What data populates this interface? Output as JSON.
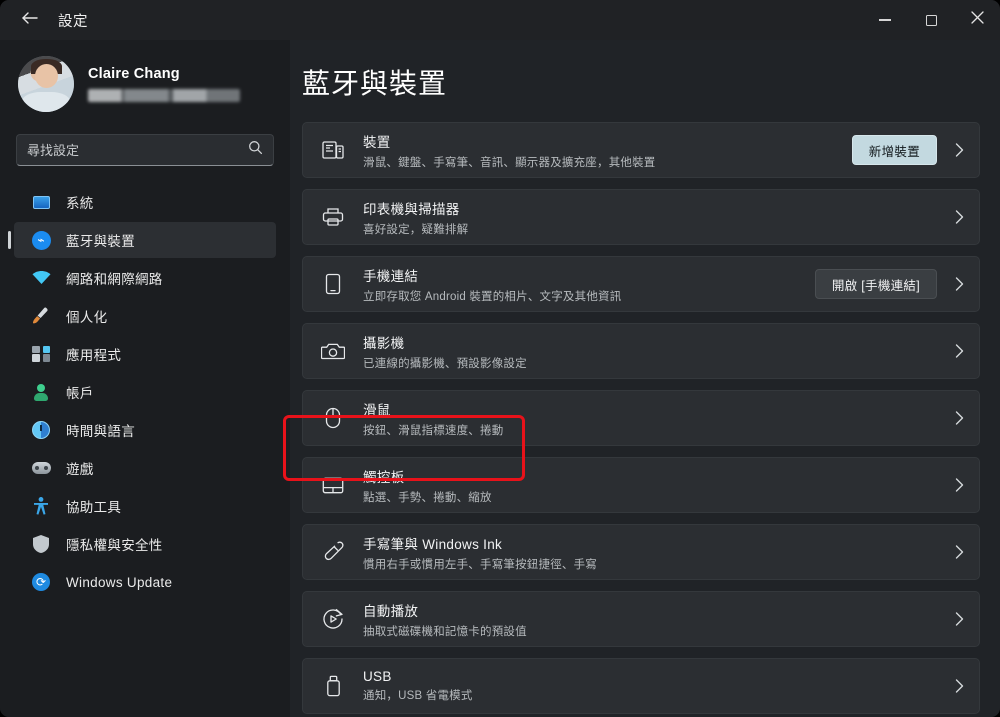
{
  "window": {
    "title": "設定",
    "back_icon": "back-arrow-icon",
    "controls": {
      "minimize": "minimize-icon",
      "maximize": "maximize-icon",
      "close": "close-icon"
    }
  },
  "sidebar": {
    "profile": {
      "name": "Claire Chang",
      "email_redacted": true,
      "avatar": "user-avatar"
    },
    "search": {
      "placeholder": "尋找設定",
      "value": "",
      "icon": "search-icon"
    },
    "items": [
      {
        "label": "系統",
        "icon": "system-icon",
        "selected": false
      },
      {
        "label": "藍牙與裝置",
        "icon": "bluetooth-icon",
        "selected": true
      },
      {
        "label": "網路和網際網路",
        "icon": "wifi-icon",
        "selected": false
      },
      {
        "label": "個人化",
        "icon": "personalize-icon",
        "selected": false
      },
      {
        "label": "應用程式",
        "icon": "apps-icon",
        "selected": false
      },
      {
        "label": "帳戶",
        "icon": "account-icon",
        "selected": false
      },
      {
        "label": "時間與語言",
        "icon": "clock-icon",
        "selected": false
      },
      {
        "label": "遊戲",
        "icon": "gaming-icon",
        "selected": false
      },
      {
        "label": "協助工具",
        "icon": "accessibility-icon",
        "selected": false
      },
      {
        "label": "隱私權與安全性",
        "icon": "shield-icon",
        "selected": false
      },
      {
        "label": "Windows Update",
        "icon": "update-icon",
        "selected": false
      }
    ]
  },
  "main": {
    "title": "藍牙與裝置",
    "cards": [
      {
        "title": "裝置",
        "subtitle": "滑鼠、鍵盤、手寫筆、音訊、顯示器及擴充座，其他裝置",
        "icon": "devices-icon",
        "action": {
          "label": "新增裝置",
          "style": "accent"
        },
        "chevron": "chevron-right-icon"
      },
      {
        "title": "印表機與掃描器",
        "subtitle": "喜好設定，疑難排解",
        "icon": "printer-icon",
        "action": null,
        "chevron": "chevron-right-icon"
      },
      {
        "title": "手機連結",
        "subtitle": "立即存取您 Android 裝置的相片、文字及其他資訊",
        "icon": "phone-icon",
        "action": {
          "label": "開啟 [手機連結]",
          "style": "secondary"
        },
        "chevron": "chevron-right-icon"
      },
      {
        "title": "攝影機",
        "subtitle": "已連線的攝影機、預設影像設定",
        "icon": "camera-icon",
        "action": null,
        "chevron": "chevron-right-icon"
      },
      {
        "title": "滑鼠",
        "subtitle": "按鈕、滑鼠指標速度、捲動",
        "icon": "mouse-icon",
        "action": null,
        "chevron": "chevron-right-icon"
      },
      {
        "title": "觸控板",
        "subtitle": "點選、手勢、捲動、縮放",
        "icon": "touchpad-icon",
        "action": null,
        "chevron": "chevron-right-icon",
        "highlighted": true
      },
      {
        "title": "手寫筆與 Windows Ink",
        "subtitle": "慣用右手或慣用左手、手寫筆按鈕捷徑、手寫",
        "icon": "pen-icon",
        "action": null,
        "chevron": "chevron-right-icon"
      },
      {
        "title": "自動播放",
        "subtitle": "抽取式磁碟機和記憶卡的預設值",
        "icon": "autoplay-icon",
        "action": null,
        "chevron": "chevron-right-icon"
      },
      {
        "title": "USB",
        "subtitle": "通知，USB 省電模式",
        "icon": "usb-icon",
        "action": null,
        "chevron": "chevron-right-icon"
      }
    ]
  },
  "annotation": {
    "highlight_color": "#e8121a",
    "target": "觸控板"
  },
  "colors": {
    "window_bg": "#1b1d20",
    "main_bg": "#202327",
    "card_bg": "#2b2e32",
    "accent_button": "#c3d9e0",
    "bluetooth_blue": "#1b8cf0"
  }
}
